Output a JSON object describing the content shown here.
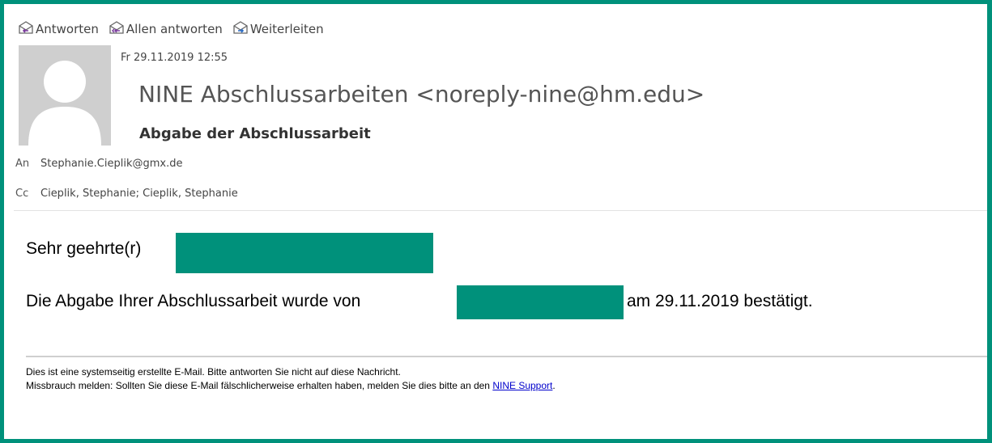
{
  "toolbar": {
    "reply": "Antworten",
    "reply_all": "Allen antworten",
    "forward": "Weiterleiten"
  },
  "header": {
    "date": "Fr 29.11.2019 12:55",
    "sender": "NINE Abschlussarbeiten <noreply-nine@hm.edu>",
    "subject": "Abgabe der Abschlussarbeit"
  },
  "recipients": {
    "to_label": "An",
    "to": "Stephanie.Cieplik@gmx.de",
    "cc_label": "Cc",
    "cc": "Cieplik, Stephanie; Cieplik, Stephanie"
  },
  "body": {
    "greeting": "Sehr geehrte(r)",
    "message_prefix": "Die Abgabe Ihrer Abschlussarbeit wurde von",
    "message_suffix": "am 29.11.2019 bestätigt."
  },
  "footer": {
    "line1": "Dies ist eine systemseitig erstellte E-Mail. Bitte antworten Sie nicht auf diese Nachricht.",
    "line2_prefix": "Missbrauch melden: Sollten Sie diese E-Mail fälschlicherweise erhalten haben, melden Sie dies bitte an den",
    "link_text": "NINE Support",
    "line2_suffix": "."
  },
  "colors": {
    "frame": "#00917b",
    "redaction": "#00917b",
    "link": "#0000cc"
  },
  "icons": {
    "reply": "reply-icon",
    "reply_all": "reply-all-icon",
    "forward": "forward-icon"
  }
}
